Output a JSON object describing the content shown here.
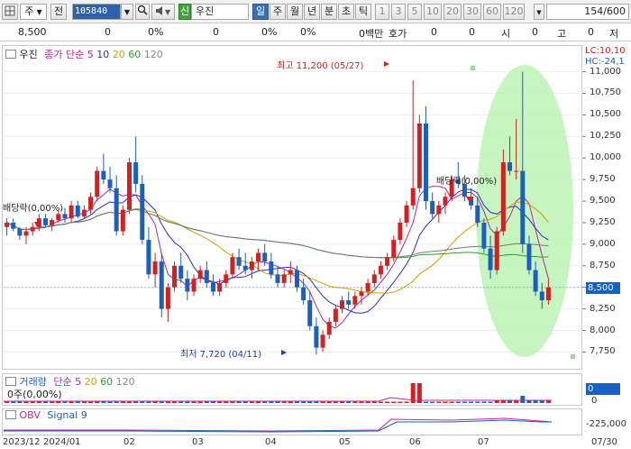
{
  "toolbar": {
    "type_label": "주",
    "prev_label": "전",
    "code": "105840",
    "stock_name_prefix": "신",
    "stock_name": "우진",
    "period_day": "일",
    "period_week": "주",
    "period_month": "월",
    "period_year": "년",
    "period_minute": "분",
    "period_second": "초",
    "period_tick": "틱",
    "intervals": [
      "1",
      "3",
      "5",
      "10",
      "20",
      "30",
      "60",
      "120"
    ],
    "page_count": "154",
    "page_total": "/600"
  },
  "infobar": {
    "price": "8,500",
    "change": "0",
    "change2": "0",
    "pct1": "0%",
    "pct2": "0%",
    "volume": "0백만",
    "quote_label": "호가",
    "quote_value": "0",
    "open_value": "0",
    "open_label": "시",
    "high_value": "0",
    "high_label": "고",
    "low_value": "0",
    "low_label": "저"
  },
  "price_pane": {
    "title": "우진",
    "ma_label": "종가 단순 5",
    "ma_periods": [
      "10",
      "20",
      "60",
      "120"
    ],
    "ma_colors": [
      "#2a2adb",
      "#d2a000",
      "#2aa02a",
      "#777777"
    ],
    "lc_label": "LC:10,10",
    "hc_label": "HC:-24,1",
    "y_ticks": [
      "11,000",
      "10,750",
      "10,500",
      "10,250",
      "10,000",
      "9,750",
      "9,500",
      "9,250",
      "9,000",
      "8,750",
      "8,500",
      "8,250",
      "8,000",
      "7,750"
    ],
    "current_price": "8,500",
    "high_annotation": "최고 11,200 (05/27)",
    "low_annotation": "최저 7,720 (04/11)",
    "dividend_label_1": "배당락(0,00%)",
    "dividend_label_2": "배당락(0,00%)"
  },
  "volume_pane": {
    "title": "거래량",
    "ma_label": "단순 5",
    "ma_periods": [
      "20",
      "60",
      "120"
    ],
    "left_value": "0주(0,00%)",
    "right_value": "0",
    "right_value2": "0"
  },
  "obv_pane": {
    "title": "OBV",
    "signal_label": "Signal 9",
    "right_value": "-225,000"
  },
  "x_axis": {
    "labels": [
      "2023/12",
      "2024/01",
      "02",
      "03",
      "04",
      "05",
      "06",
      "07",
      "07/30"
    ]
  },
  "chart_data": {
    "type": "candlestick",
    "ylim": [
      7650,
      11100
    ],
    "candles": [
      [
        9200,
        9300,
        9100,
        9250
      ],
      [
        9250,
        9300,
        9150,
        9180
      ],
      [
        9180,
        9200,
        9050,
        9100
      ],
      [
        9100,
        9200,
        9000,
        9150
      ],
      [
        9150,
        9250,
        9100,
        9200
      ],
      [
        9200,
        9350,
        9150,
        9300
      ],
      [
        9300,
        9350,
        9200,
        9220
      ],
      [
        9220,
        9300,
        9150,
        9280
      ],
      [
        9280,
        9400,
        9250,
        9350
      ],
      [
        9350,
        9420,
        9250,
        9300
      ],
      [
        9300,
        9500,
        9250,
        9450
      ],
      [
        9450,
        9500,
        9300,
        9320
      ],
      [
        9320,
        9450,
        9300,
        9400
      ],
      [
        9400,
        9600,
        9350,
        9550
      ],
      [
        9550,
        9900,
        9500,
        9850
      ],
      [
        9850,
        10050,
        9700,
        9750
      ],
      [
        9750,
        9900,
        9600,
        9650
      ],
      [
        9650,
        9800,
        9100,
        9150
      ],
      [
        9150,
        9450,
        9100,
        9400
      ],
      [
        9400,
        10000,
        9350,
        9950
      ],
      [
        9950,
        10250,
        9600,
        9700
      ],
      [
        9700,
        9800,
        9000,
        9050
      ],
      [
        9050,
        9200,
        8600,
        8650
      ],
      [
        8650,
        8900,
        8500,
        8800
      ],
      [
        8800,
        8900,
        8150,
        8250
      ],
      [
        8250,
        8550,
        8100,
        8500
      ],
      [
        8500,
        8800,
        8450,
        8750
      ],
      [
        8750,
        8900,
        8550,
        8600
      ],
      [
        8600,
        8700,
        8350,
        8450
      ],
      [
        8450,
        8650,
        8400,
        8600
      ],
      [
        8600,
        8750,
        8550,
        8700
      ],
      [
        8700,
        8800,
        8500,
        8550
      ],
      [
        8550,
        8650,
        8400,
        8450
      ],
      [
        8450,
        8600,
        8400,
        8550
      ],
      [
        8550,
        8700,
        8500,
        8650
      ],
      [
        8650,
        8900,
        8600,
        8850
      ],
      [
        8850,
        8950,
        8700,
        8750
      ],
      [
        8750,
        8900,
        8650,
        8700
      ],
      [
        8700,
        8850,
        8600,
        8800
      ],
      [
        8800,
        8950,
        8700,
        8900
      ],
      [
        8900,
        9000,
        8750,
        8800
      ],
      [
        8800,
        8900,
        8600,
        8650
      ],
      [
        8650,
        8750,
        8500,
        8550
      ],
      [
        8550,
        8700,
        8500,
        8650
      ],
      [
        8650,
        8800,
        8550,
        8700
      ],
      [
        8700,
        8750,
        8450,
        8500
      ],
      [
        8500,
        8600,
        8300,
        8350
      ],
      [
        8350,
        8450,
        8000,
        8050
      ],
      [
        8050,
        8150,
        7720,
        7800
      ],
      [
        7800,
        8000,
        7750,
        7950
      ],
      [
        7950,
        8150,
        7900,
        8100
      ],
      [
        8100,
        8300,
        8050,
        8250
      ],
      [
        8250,
        8400,
        8200,
        8350
      ],
      [
        8350,
        8450,
        8250,
        8300
      ],
      [
        8300,
        8450,
        8250,
        8400
      ],
      [
        8400,
        8500,
        8300,
        8450
      ],
      [
        8450,
        8600,
        8400,
        8550
      ],
      [
        8550,
        8700,
        8500,
        8650
      ],
      [
        8650,
        8800,
        8600,
        8750
      ],
      [
        8750,
        8900,
        8700,
        8850
      ],
      [
        8850,
        9100,
        8800,
        9050
      ],
      [
        9050,
        9300,
        9000,
        9250
      ],
      [
        9250,
        9500,
        9200,
        9450
      ],
      [
        9450,
        10900,
        9400,
        9650
      ],
      [
        9650,
        10500,
        9600,
        10400
      ],
      [
        10400,
        10600,
        9400,
        9500
      ],
      [
        9500,
        9600,
        9300,
        9350
      ],
      [
        9350,
        9500,
        9250,
        9450
      ],
      [
        9450,
        9600,
        9350,
        9550
      ],
      [
        9550,
        9800,
        9500,
        9750
      ],
      [
        9750,
        9950,
        9650,
        9700
      ],
      [
        9700,
        9800,
        9500,
        9550
      ],
      [
        9550,
        9650,
        9400,
        9450
      ],
      [
        9450,
        9550,
        9200,
        9250
      ],
      [
        9250,
        9300,
        8900,
        8950
      ],
      [
        8950,
        9100,
        8600,
        8700
      ],
      [
        8700,
        9200,
        8650,
        9150
      ],
      [
        9150,
        10100,
        9100,
        9950
      ],
      [
        9950,
        10250,
        9800,
        9850
      ],
      [
        9850,
        10450,
        9750,
        9850
      ],
      [
        9850,
        11000,
        8900,
        9000
      ],
      [
        9000,
        9100,
        8650,
        8700
      ],
      [
        8700,
        8800,
        8400,
        8450
      ],
      [
        8450,
        8550,
        8250,
        8350
      ],
      [
        8350,
        8600,
        8300,
        8500
      ]
    ]
  }
}
